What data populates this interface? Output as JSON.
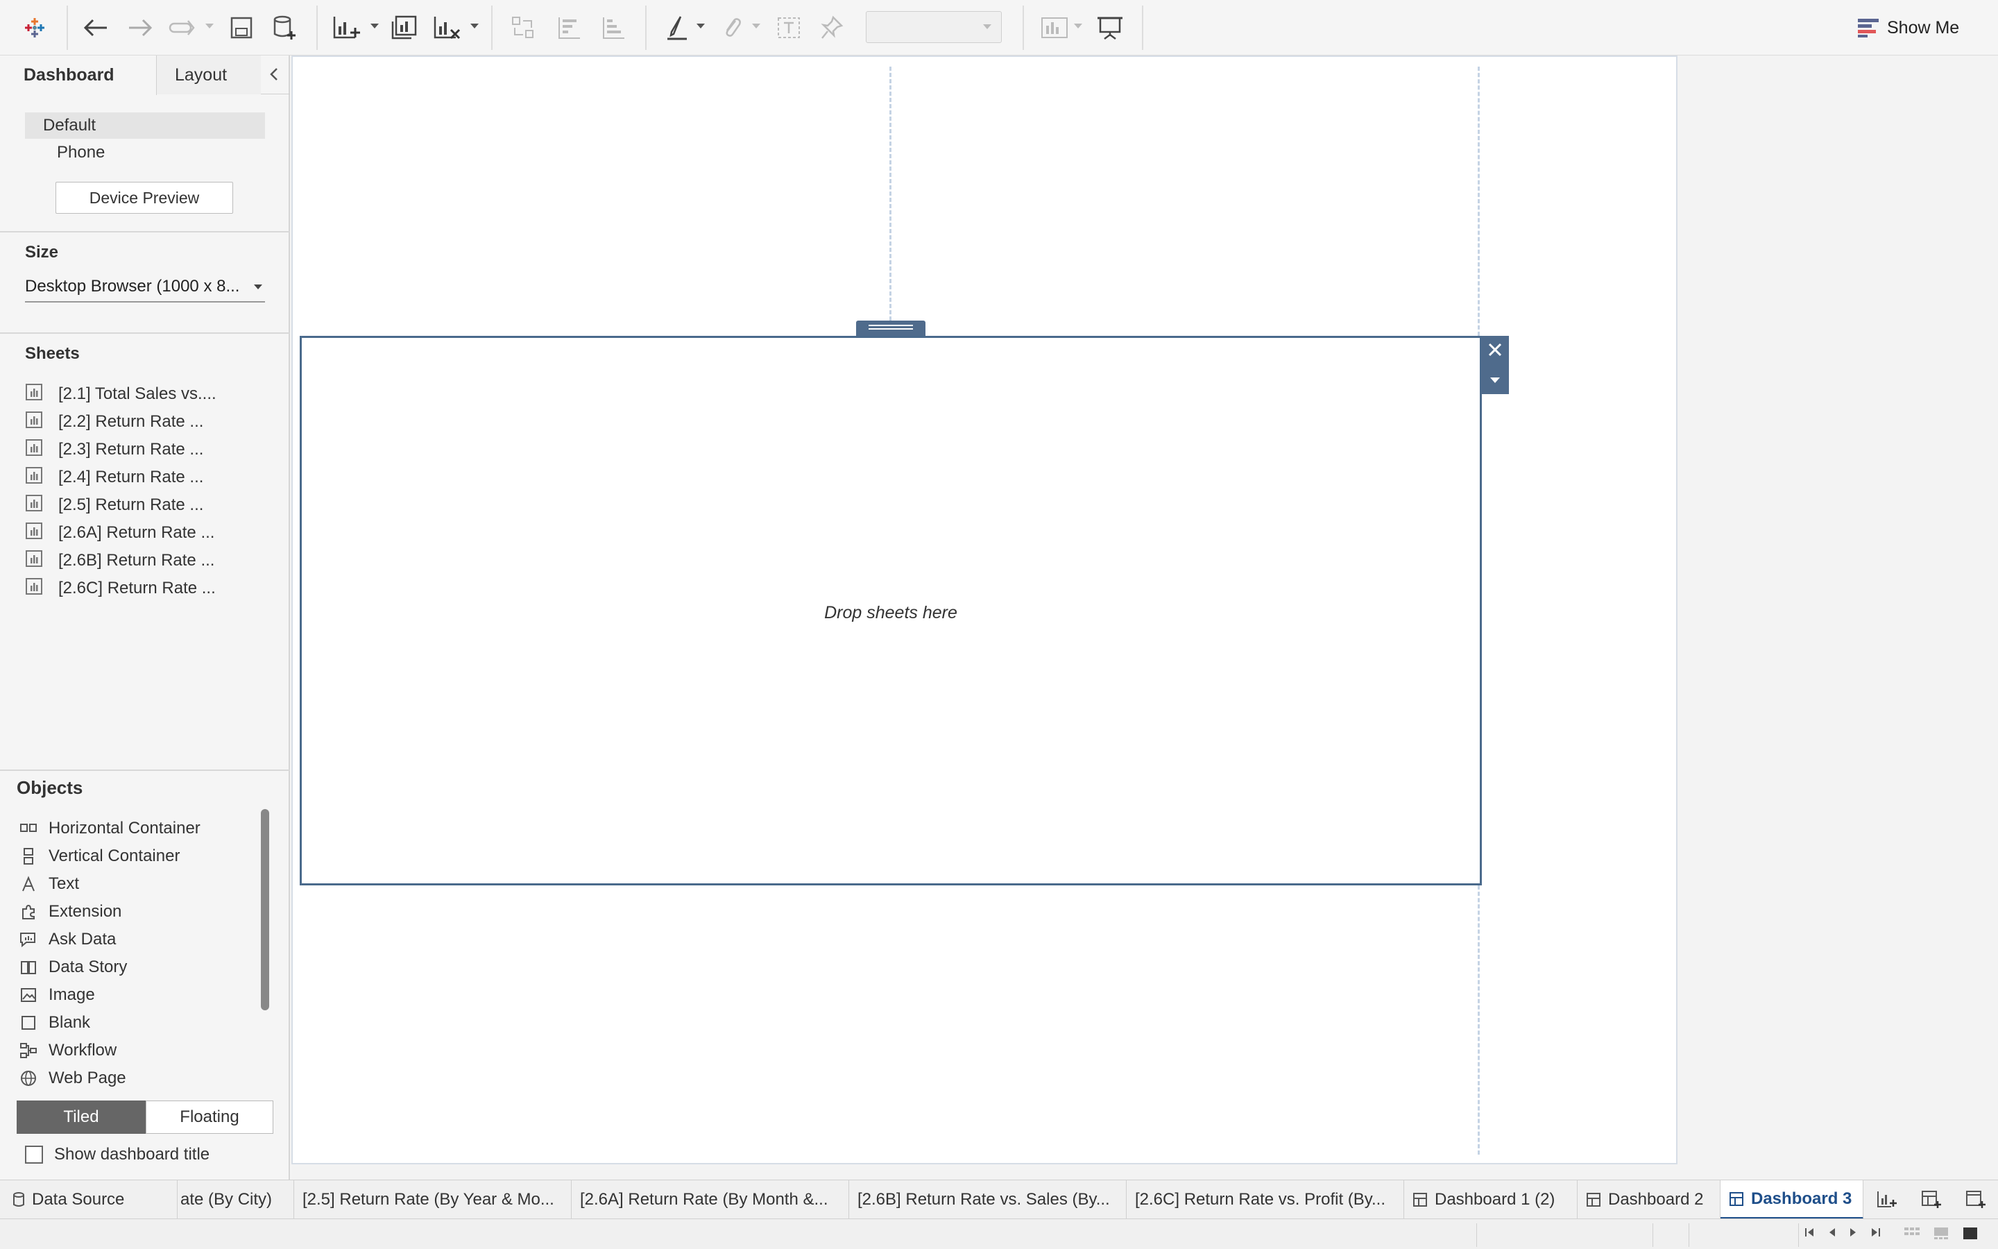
{
  "toolbar": {
    "show_me_label": "Show Me"
  },
  "left_panel": {
    "tabs": {
      "dashboard": "Dashboard",
      "layout": "Layout"
    },
    "device": {
      "default": "Default",
      "phone": "Phone",
      "preview_button": "Device Preview"
    },
    "size": {
      "title": "Size",
      "value": "Desktop Browser (1000 x 8..."
    },
    "sheets": {
      "title": "Sheets",
      "items": [
        "[2.1] Total Sales vs....",
        "[2.2] Return Rate ...",
        "[2.3] Return Rate ...",
        "[2.4] Return Rate ...",
        "[2.5] Return Rate ...",
        "[2.6A] Return Rate ...",
        "[2.6B] Return Rate ...",
        "[2.6C] Return Rate ..."
      ]
    },
    "objects": {
      "title": "Objects",
      "items": [
        {
          "label": "Horizontal Container",
          "icon": "horizontal-container-icon"
        },
        {
          "label": "Vertical Container",
          "icon": "vertical-container-icon"
        },
        {
          "label": "Text",
          "icon": "text-icon"
        },
        {
          "label": "Extension",
          "icon": "extension-icon"
        },
        {
          "label": "Ask Data",
          "icon": "ask-data-icon"
        },
        {
          "label": "Data Story",
          "icon": "data-story-icon"
        },
        {
          "label": "Image",
          "icon": "image-icon"
        },
        {
          "label": "Blank",
          "icon": "blank-icon"
        },
        {
          "label": "Workflow",
          "icon": "workflow-icon"
        },
        {
          "label": "Web Page",
          "icon": "web-page-icon"
        }
      ],
      "tiled_label": "Tiled",
      "floating_label": "Floating",
      "show_title_label": "Show dashboard title",
      "show_title_checked": false
    }
  },
  "canvas": {
    "drop_text": "Drop sheets here"
  },
  "bottom_tabs": {
    "data_source": "Data Source",
    "tabs": [
      "ate (By City)",
      "[2.5] Return Rate (By Year & Mo...",
      "[2.6A] Return Rate (By Month &...",
      "[2.6B] Return Rate vs. Sales (By...",
      "[2.6C] Return Rate vs. Profit (By...",
      "Dashboard 1 (2)",
      "Dashboard 2",
      "Dashboard 3"
    ],
    "active_tab": "Dashboard 3"
  },
  "colors": {
    "accent": "#1f4f8a",
    "selection_border": "#4a6a8c",
    "guide_dash": "#c5d3e4"
  }
}
